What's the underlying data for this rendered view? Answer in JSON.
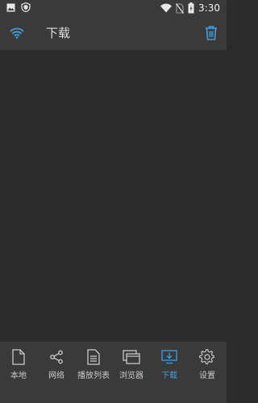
{
  "status_bar": {
    "time": "3:30",
    "icons": [
      "gallery-icon",
      "shield-icon",
      "wifi-icon",
      "no-sim-icon",
      "battery-icon"
    ]
  },
  "toolbar": {
    "title": "下载",
    "left_icon": "wifi-icon",
    "right_icon": "trash-icon"
  },
  "bottom_nav": {
    "active_index": 4,
    "accent_color": "#3e9fe0",
    "items": [
      {
        "label": "本地",
        "icon": "file-icon"
      },
      {
        "label": "网络",
        "icon": "share-icon"
      },
      {
        "label": "播放列表",
        "icon": "playlist-icon"
      },
      {
        "label": "浏览器",
        "icon": "browser-icon"
      },
      {
        "label": "下载",
        "icon": "download-icon"
      },
      {
        "label": "设置",
        "icon": "settings-icon"
      }
    ]
  }
}
